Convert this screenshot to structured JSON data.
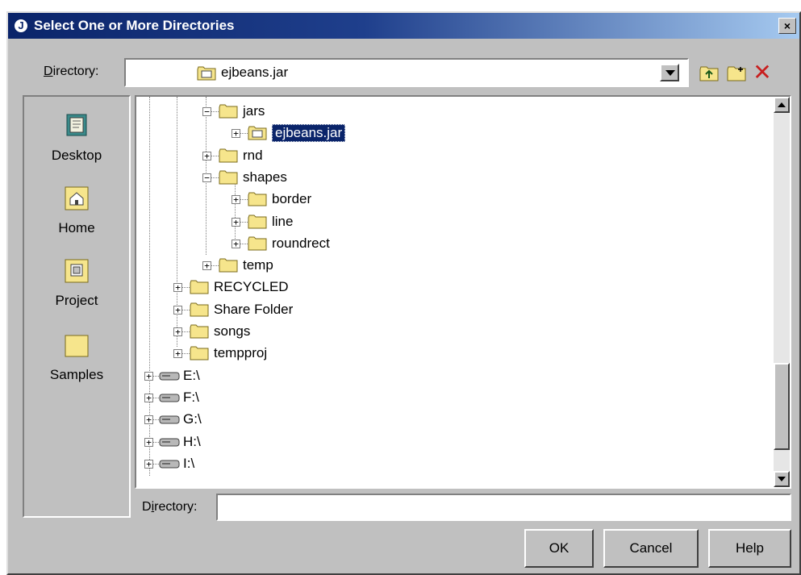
{
  "window": {
    "title": "Select One or More Directories",
    "close_label": "×"
  },
  "toolbar": {
    "directory_label": "Directory:",
    "directory_value": "ejbeans.jar",
    "buttons": [
      "folder-up-icon",
      "new-folder-icon",
      "delete-icon"
    ]
  },
  "places": [
    {
      "label": "Desktop",
      "icon": "desktop-icon"
    },
    {
      "label": "Home",
      "icon": "home-icon"
    },
    {
      "label": "Project",
      "icon": "project-icon"
    },
    {
      "label": "Samples",
      "icon": "samples-folder-icon"
    }
  ],
  "tree": [
    {
      "label": "jars",
      "expander": "−",
      "kind": "folder",
      "selected": false
    },
    {
      "label": "ejbeans.jar",
      "expander": "+",
      "kind": "jar",
      "selected": true
    },
    {
      "label": "rnd",
      "expander": "+",
      "kind": "folder",
      "selected": false
    },
    {
      "label": "shapes",
      "expander": "−",
      "kind": "folder",
      "selected": false
    },
    {
      "label": "border",
      "expander": "+",
      "kind": "folder",
      "selected": false
    },
    {
      "label": "line",
      "expander": "+",
      "kind": "folder",
      "selected": false
    },
    {
      "label": "roundrect",
      "expander": "+",
      "kind": "folder",
      "selected": false
    },
    {
      "label": "temp",
      "expander": "+",
      "kind": "folder",
      "selected": false
    },
    {
      "label": "RECYCLED",
      "expander": "+",
      "kind": "folder",
      "selected": false
    },
    {
      "label": "Share Folder",
      "expander": "+",
      "kind": "folder",
      "selected": false
    },
    {
      "label": "songs",
      "expander": "+",
      "kind": "folder",
      "selected": false
    },
    {
      "label": "tempproj",
      "expander": "+",
      "kind": "folder",
      "selected": false
    },
    {
      "label": "E:\\",
      "expander": "+",
      "kind": "drive",
      "selected": false
    },
    {
      "label": "F:\\",
      "expander": "+",
      "kind": "drive",
      "selected": false
    },
    {
      "label": "G:\\",
      "expander": "+",
      "kind": "drive",
      "selected": false
    },
    {
      "label": "H:\\",
      "expander": "+",
      "kind": "drive",
      "selected": false
    },
    {
      "label": "I:\\",
      "expander": "+",
      "kind": "drive",
      "selected": false
    }
  ],
  "footer": {
    "directory_label": "Directory:",
    "directory_value": "",
    "ok": "OK",
    "cancel": "Cancel",
    "help": "Help"
  },
  "colors": {
    "title_bar": "#0a246a",
    "selection": "#0a246a",
    "face": "#c0c0c0",
    "folder": "#f6e58c"
  }
}
